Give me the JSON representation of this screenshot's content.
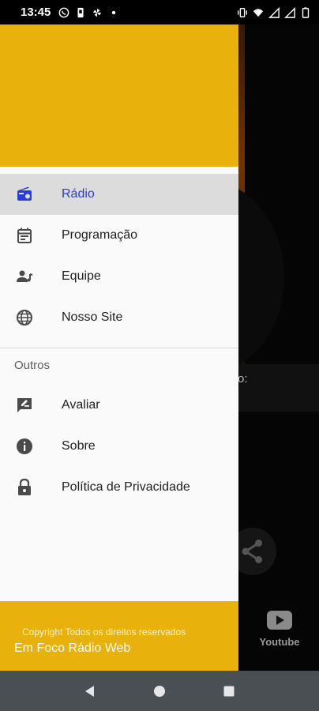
{
  "status_bar": {
    "time": "13:45",
    "left_icons": [
      "whatsapp-icon",
      "sim-icon",
      "pinwheel-icon",
      "dot-icon"
    ],
    "right_icons": [
      "vibrate-icon",
      "wifi-icon",
      "signal-icon",
      "signal-icon",
      "battery-icon"
    ]
  },
  "drawer": {
    "menu_items": [
      {
        "label": "Rádio",
        "icon": "radio-icon",
        "active": true
      },
      {
        "label": "Programação",
        "icon": "calendar-icon",
        "active": false
      },
      {
        "label": "Equipe",
        "icon": "team-icon",
        "active": false
      },
      {
        "label": "Nosso Site",
        "icon": "globe-icon",
        "active": false
      }
    ],
    "section_title": "Outros",
    "other_items": [
      {
        "label": "Avaliar",
        "icon": "rate-icon"
      },
      {
        "label": "Sobre",
        "icon": "info-icon"
      },
      {
        "label": "Política de Privacidade",
        "icon": "lock-icon"
      }
    ],
    "footer": {
      "copyright": "Copyright Todos os direitos reservados",
      "app_name": "Em Foco Rádio Web"
    }
  },
  "background": {
    "label_fragment": "o:",
    "youtube_label": "Youtube"
  },
  "colors": {
    "accent": "#e8b10c",
    "active_text": "#2a3ed0",
    "active_bg": "#dcdcdc",
    "icon": "#4a4a4a"
  }
}
